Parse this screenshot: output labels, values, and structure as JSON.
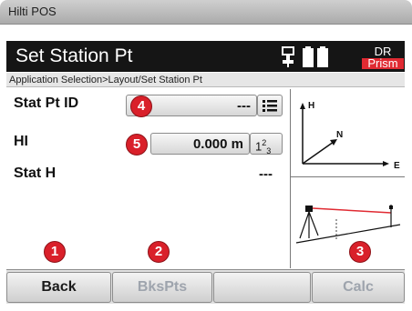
{
  "app": {
    "title": "Hilti POS"
  },
  "header": {
    "title": "Set Station Pt",
    "mode_line1": "DR",
    "mode_line2": "Prism",
    "icons": [
      "instrument-icon",
      "battery-icon"
    ]
  },
  "breadcrumb": "Application Selection>Layout/Set Station Pt",
  "fields": {
    "stat_pt_id": {
      "label": "Stat Pt ID",
      "value": "---",
      "badge": "4"
    },
    "hi": {
      "label": "HI",
      "value": "0.000 m",
      "badge": "5",
      "keypad_label_main": "1",
      "keypad_label_sup": "2",
      "keypad_label_sub": "3"
    },
    "stat_h": {
      "label": "Stat H",
      "value": "---"
    }
  },
  "axes_diagram": {
    "h_label": "H",
    "n_label": "N",
    "e_label": "E"
  },
  "softkeys": [
    {
      "label": "Back",
      "badge": "1",
      "enabled": true
    },
    {
      "label": "BksPts",
      "badge": "2",
      "enabled": false
    },
    {
      "label": "",
      "badge": "",
      "enabled": false
    },
    {
      "label": "Calc",
      "badge": "3",
      "enabled": false
    }
  ],
  "colors": {
    "badge": "#d9202a",
    "header_bg": "#151515",
    "prism_bg": "#e02a32"
  }
}
